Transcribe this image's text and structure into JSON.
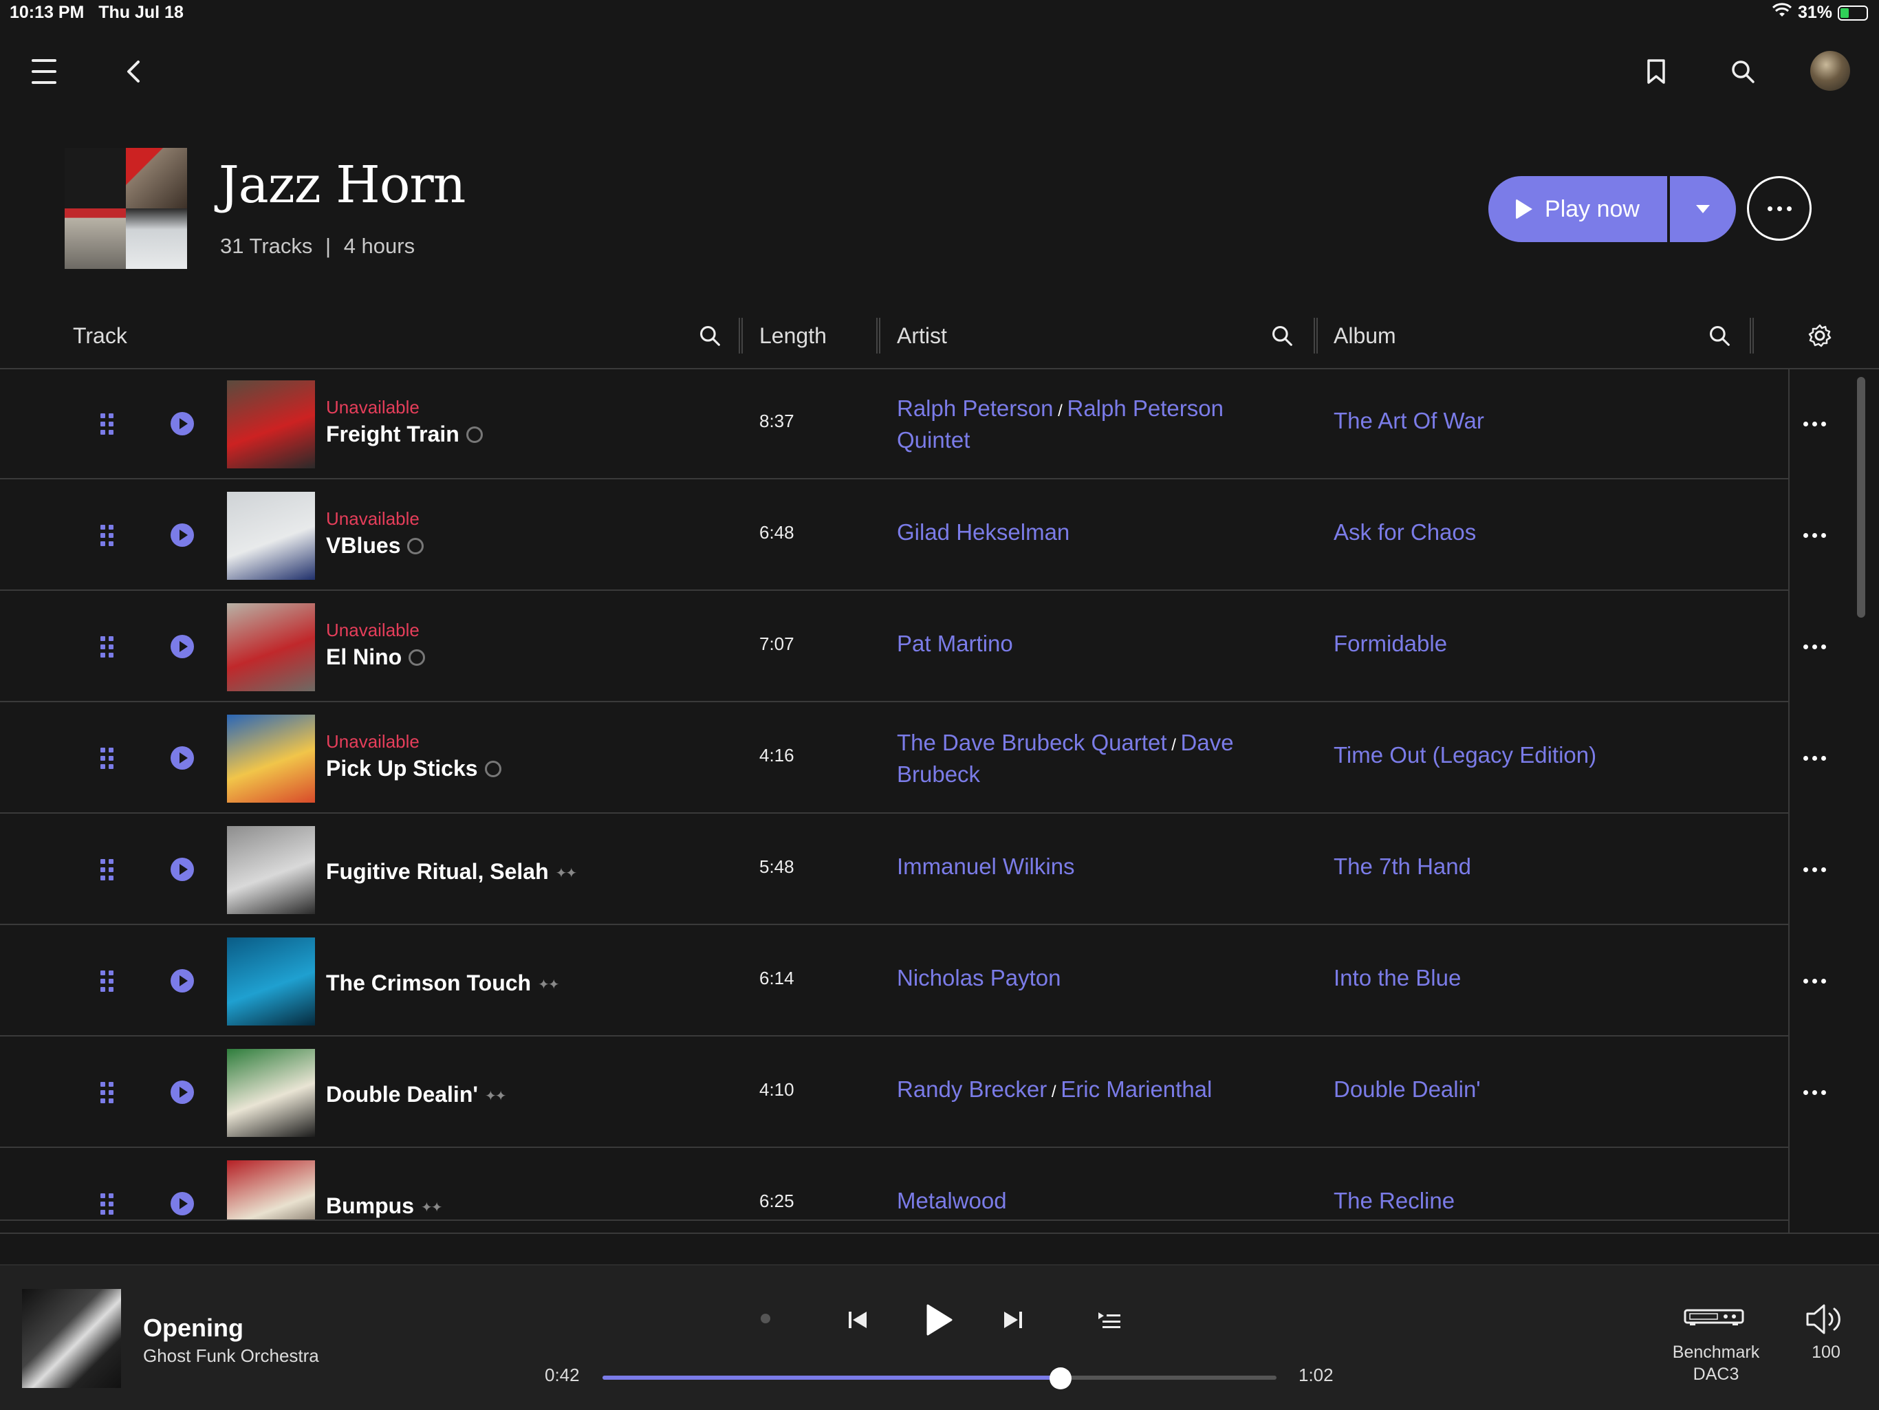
{
  "status": {
    "time": "10:13 PM",
    "date": "Thu Jul 18",
    "battery": "31%"
  },
  "playlist": {
    "title": "Jazz Horn",
    "tracks": "31 Tracks",
    "separator": "|",
    "duration": "4 hours"
  },
  "actions": {
    "play_now": "Play now"
  },
  "columns": {
    "track": "Track",
    "length": "Length",
    "artist": "Artist",
    "album": "Album"
  },
  "rows": [
    {
      "unavailable": "Unavailable",
      "name": "Freight Train",
      "length": "8:37",
      "artists": [
        "Ralph Peterson",
        "Ralph Peterson Quintet"
      ],
      "album": "The Art Of War"
    },
    {
      "unavailable": "Unavailable",
      "name": "VBlues",
      "length": "6:48",
      "artists": [
        "Gilad Hekselman"
      ],
      "album": "Ask for Chaos"
    },
    {
      "unavailable": "Unavailable",
      "name": "El Nino",
      "length": "7:07",
      "artists": [
        "Pat Martino"
      ],
      "album": "Formidable"
    },
    {
      "unavailable": "Unavailable",
      "name": "Pick Up Sticks",
      "length": "4:16",
      "artists": [
        "The Dave Brubeck Quartet",
        "Dave Brubeck"
      ],
      "album": "Time Out (Legacy Edition)"
    },
    {
      "unavailable": "",
      "name": "Fugitive Ritual, Selah",
      "length": "5:48",
      "artists": [
        "Immanuel Wilkins"
      ],
      "album": "The 7th Hand"
    },
    {
      "unavailable": "",
      "name": "The Crimson Touch",
      "length": "6:14",
      "artists": [
        "Nicholas Payton"
      ],
      "album": "Into the Blue"
    },
    {
      "unavailable": "",
      "name": "Double Dealin'",
      "length": "4:10",
      "artists": [
        "Randy Brecker",
        "Eric Marienthal"
      ],
      "album": "Double Dealin'"
    },
    {
      "unavailable": "",
      "name": "Bumpus",
      "length": "6:25",
      "artists": [
        "Metalwood"
      ],
      "album": "The Recline"
    }
  ],
  "now_playing": {
    "title": "Opening",
    "artist": "Ghost Funk Orchestra",
    "elapsed": "0:42",
    "total": "1:02",
    "progress": 0.68,
    "device_line1": "Benchmark",
    "device_line2": "DAC3",
    "volume": "100"
  },
  "colors": {
    "accent": "#7b7ce8",
    "unavailable": "#e53e5a",
    "background": "#171717"
  },
  "art_palettes": [
    [
      "#5a4b3e",
      "#c22",
      "#2a2a2a"
    ],
    [
      "#cfd3d6",
      "#e8eaeb",
      "#20306b"
    ],
    [
      "#b8b2a6",
      "#c0282b",
      "#6d6a64"
    ],
    [
      "#2a66b7",
      "#f1c54a",
      "#d84a2a"
    ],
    [
      "#8d8d8d",
      "#d9d9d9",
      "#2a2a2a"
    ],
    [
      "#0a5c86",
      "#1fa0d0",
      "#062a3d"
    ],
    [
      "#2e7d3c",
      "#e9e4d4",
      "#1b1b1b"
    ],
    [
      "#b52025",
      "#e9e1cf",
      "#3a2b20"
    ]
  ]
}
